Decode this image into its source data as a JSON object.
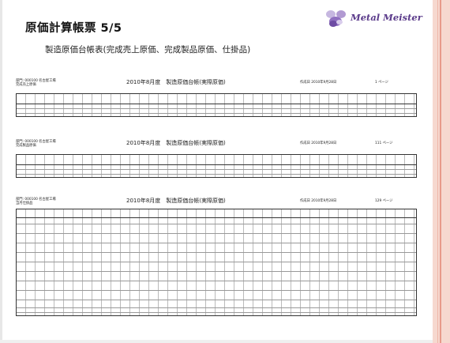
{
  "header": {
    "title": "原価計算帳票  5/5",
    "subtitle": "製造原価台帳表(完成売上原価、完成製品原価、仕掛品)",
    "logo_text": "Metal Meister"
  },
  "sheets": [
    {
      "dept_line1": "部門: 000100  名古屋工場",
      "dept_line2": "完成売上原価",
      "title": "2010年8月度　製造原価台帳(実際原価)",
      "date": "作成日 2010年9月28日",
      "page": "1  ページ"
    },
    {
      "dept_line1": "部門: 000100  名古屋工場",
      "dept_line2": "完成製品原価",
      "title": "2010年8月度　製造原価台帳(実際原価)",
      "date": "作成日 2010年9月28日",
      "page": "111  ページ"
    },
    {
      "dept_line1": "部門: 000100  名古屋工場",
      "dept_line2": "当月仕掛品",
      "title": "2010年8月度　製造原価台帳(実際原価)",
      "date": "作成日 2010年9月28日",
      "page": "129  ページ"
    }
  ],
  "colors": {
    "right_border": "#f6d8cf",
    "logo_purple": "#5a3a8a"
  },
  "icons": {
    "logo_mark": "metal-meister-logo-icon"
  }
}
